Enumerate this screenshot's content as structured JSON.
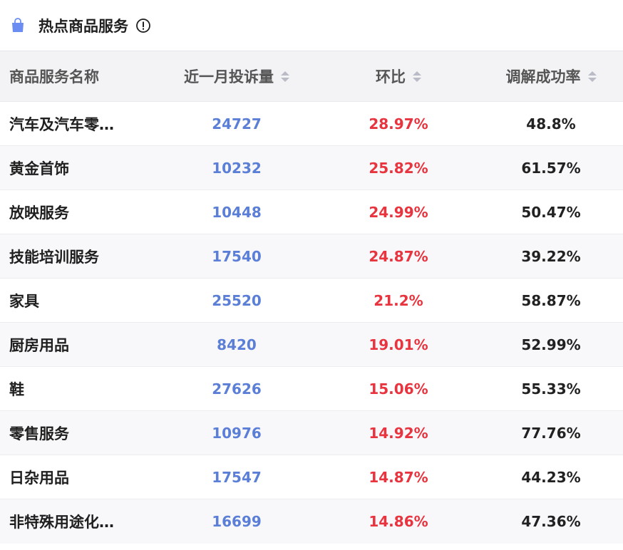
{
  "header": {
    "title": "热点商品服务",
    "bag_icon": "shopping-bag-icon",
    "info_icon": "info-icon",
    "accent": "#6b8cf0"
  },
  "table": {
    "columns": {
      "name": "商品服务名称",
      "complaints": "近一月投诉量",
      "mom": "环比",
      "rate": "调解成功率"
    },
    "rows": [
      {
        "name": "汽车及汽车零…",
        "complaints": "24727",
        "mom": "28.97%",
        "rate": "48.8%"
      },
      {
        "name": "黄金首饰",
        "complaints": "10232",
        "mom": "25.82%",
        "rate": "61.57%"
      },
      {
        "name": "放映服务",
        "complaints": "10448",
        "mom": "24.99%",
        "rate": "50.47%"
      },
      {
        "name": "技能培训服务",
        "complaints": "17540",
        "mom": "24.87%",
        "rate": "39.22%"
      },
      {
        "name": "家具",
        "complaints": "25520",
        "mom": "21.2%",
        "rate": "58.87%"
      },
      {
        "name": "厨房用品",
        "complaints": "8420",
        "mom": "19.01%",
        "rate": "52.99%"
      },
      {
        "name": "鞋",
        "complaints": "27626",
        "mom": "15.06%",
        "rate": "55.33%"
      },
      {
        "name": "零售服务",
        "complaints": "10976",
        "mom": "14.92%",
        "rate": "77.76%"
      },
      {
        "name": "日杂用品",
        "complaints": "17547",
        "mom": "14.87%",
        "rate": "44.23%"
      },
      {
        "name": "非特殊用途化…",
        "complaints": "16699",
        "mom": "14.86%",
        "rate": "47.36%"
      }
    ],
    "colors": {
      "complaints": "#5b7fd6",
      "mom": "#e8343f",
      "rate": "#222222"
    }
  }
}
